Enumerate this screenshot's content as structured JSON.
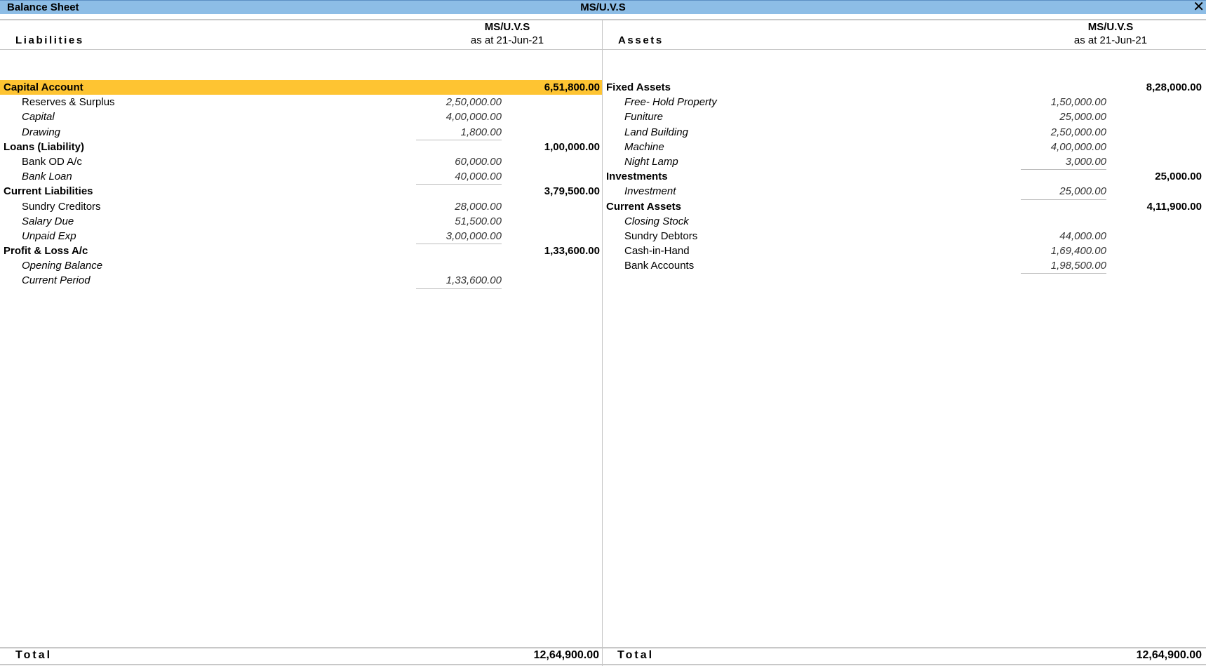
{
  "window": {
    "title": "Balance Sheet",
    "company": "MS/U.V.S",
    "close_icon": "close-icon"
  },
  "liabilities": {
    "side_title": "Liabilities",
    "company": "MS/U.V.S",
    "as_at": "as at 21-Jun-21",
    "groups": [
      {
        "name": "Capital Account",
        "amount": "6,51,800.00",
        "selected": true,
        "items": [
          {
            "name": "Reserves & Surplus",
            "amount": "2,50,000.00",
            "italic": false
          },
          {
            "name": "Capital",
            "amount": "4,00,000.00",
            "italic": true
          },
          {
            "name": "Drawing",
            "amount": "1,800.00",
            "italic": true
          }
        ]
      },
      {
        "name": "Loans (Liability)",
        "amount": "1,00,000.00",
        "selected": false,
        "items": [
          {
            "name": "Bank OD A/c",
            "amount": "60,000.00",
            "italic": false
          },
          {
            "name": "Bank Loan",
            "amount": "40,000.00",
            "italic": true
          }
        ]
      },
      {
        "name": "Current Liabilities",
        "amount": "3,79,500.00",
        "selected": false,
        "items": [
          {
            "name": "Sundry Creditors",
            "amount": "28,000.00",
            "italic": false
          },
          {
            "name": "Salary Due",
            "amount": "51,500.00",
            "italic": true
          },
          {
            "name": "Unpaid Exp",
            "amount": "3,00,000.00",
            "italic": true
          }
        ]
      },
      {
        "name": "Profit & Loss A/c",
        "amount": "1,33,600.00",
        "selected": false,
        "items": [
          {
            "name": "Opening Balance",
            "amount": "",
            "italic": true
          },
          {
            "name": "Current Period",
            "amount": "1,33,600.00",
            "italic": true
          }
        ]
      }
    ],
    "total_label": "Total",
    "total": "12,64,900.00"
  },
  "assets": {
    "side_title": "Assets",
    "company": "MS/U.V.S",
    "as_at": "as at 21-Jun-21",
    "groups": [
      {
        "name": "Fixed Assets",
        "amount": "8,28,000.00",
        "selected": false,
        "items": [
          {
            "name": "Free- Hold Property",
            "amount": "1,50,000.00",
            "italic": true
          },
          {
            "name": "Funiture",
            "amount": "25,000.00",
            "italic": true
          },
          {
            "name": "Land Building",
            "amount": "2,50,000.00",
            "italic": true
          },
          {
            "name": "Machine",
            "amount": "4,00,000.00",
            "italic": true
          },
          {
            "name": "Night Lamp",
            "amount": "3,000.00",
            "italic": true
          }
        ]
      },
      {
        "name": "Investments",
        "amount": "25,000.00",
        "selected": false,
        "items": [
          {
            "name": "Investment",
            "amount": "25,000.00",
            "italic": true
          }
        ]
      },
      {
        "name": "Current Assets",
        "amount": "4,11,900.00",
        "selected": false,
        "items": [
          {
            "name": "Closing Stock",
            "amount": "",
            "italic": true
          },
          {
            "name": "Sundry Debtors",
            "amount": "44,000.00",
            "italic": false
          },
          {
            "name": "Cash-in-Hand",
            "amount": "1,69,400.00",
            "italic": false
          },
          {
            "name": "Bank Accounts",
            "amount": "1,98,500.00",
            "italic": false
          }
        ]
      }
    ],
    "total_label": "Total",
    "total": "12,64,900.00"
  },
  "colors": {
    "titlebar": "#8dbde6",
    "selected_row": "#fec432"
  }
}
